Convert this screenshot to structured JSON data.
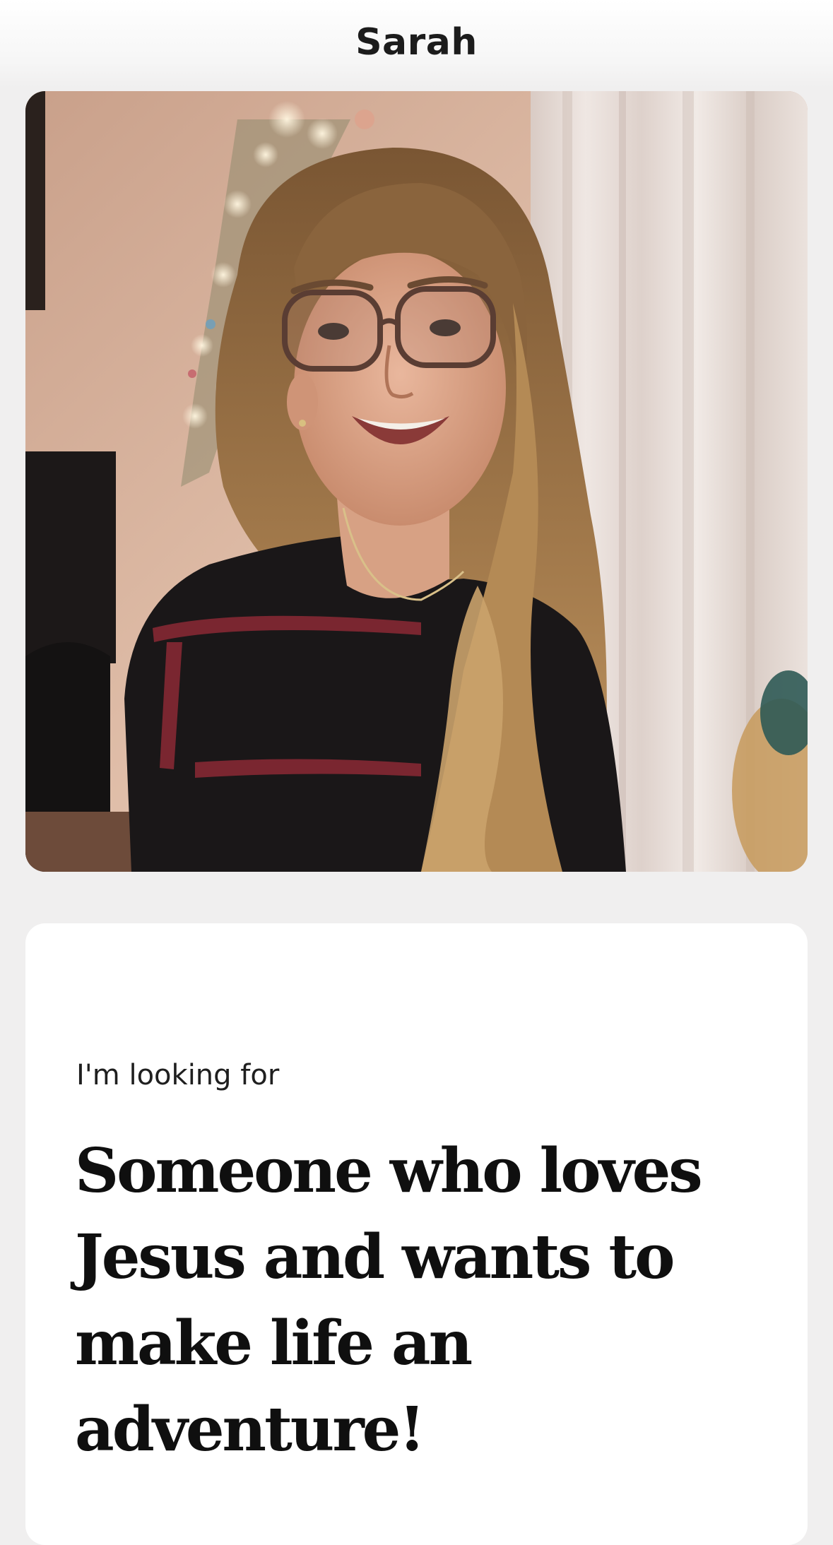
{
  "header": {
    "name": "Sarah"
  },
  "photo": {
    "description": "profile-photo",
    "colors": {
      "wall": "#dcbaa4",
      "curtain": "#e6ddd9",
      "sweater": "#1a1718",
      "stripe": "#7a2630",
      "hair": "#a07a4c"
    }
  },
  "prompt": {
    "label": "I'm looking for",
    "answer": "Someone who loves Jesus and wants to make life an adventure!"
  }
}
